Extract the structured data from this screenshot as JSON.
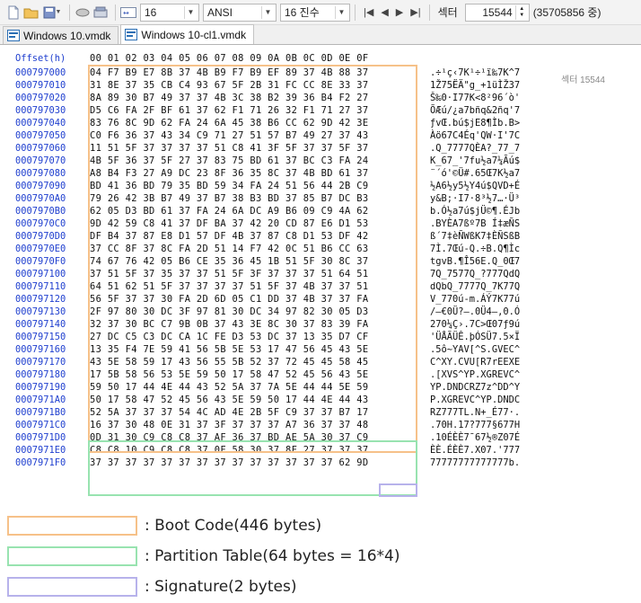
{
  "toolbar": {
    "font_size": "16",
    "charset": "ANSI",
    "radix": "16 진수",
    "sector_label": "섹터",
    "sector_value": "15544",
    "sector_total": "(35705856 중)"
  },
  "tabs": [
    {
      "label": "Windows 10.vmdk",
      "active": false
    },
    {
      "label": "Windows 10-cl1.vmdk",
      "active": true
    }
  ],
  "hex": {
    "offset_header": "Offset(h)",
    "byte_header": "00 01 02 03 04 05 06 07 08 09 0A 0B 0C 0D 0E 0F",
    "sector_note": "섹터 15544",
    "rows": [
      {
        "offset": "000797000",
        "bytes": "04 F7 B9 E7 8B 37 4B B9 F7 B9 EF 89 37 4B 88 37",
        "text": ".÷¹ç‹7K¹÷¹ï‰7K^7"
      },
      {
        "offset": "000797010",
        "bytes": "31 8E 37 35 CB C4 93 67 5F 2B 31 FC CC 8E 33 37",
        "text": "1Ž75ËÄ\"g_+1üÌŽ37"
      },
      {
        "offset": "000797020",
        "bytes": "8A 89 30 B7 49 37 37 4B 3C 38 B2 39 36 B4 F2 27",
        "text": "Š‰0·I77K<8²96´ò'"
      },
      {
        "offset": "000797030",
        "bytes": "D5 C6 FA 2F BF 61 37 62 F1 71 26 32 F1 71 27 37",
        "text": "ÕÆú/¿a7bñq&2ñq'7"
      },
      {
        "offset": "000797040",
        "bytes": "83 76 8C 9D 62 FA 24 6A 45 38 B6 CC 62 9D 42 3E",
        "text": "ƒvŒ.bú$jE8¶Ìb.B>"
      },
      {
        "offset": "000797050",
        "bytes": "C0 F6 36 37 43 34 C9 71 27 51 57 B7 49 27 37 43",
        "text": "Àö67C4Éq'QW·I'7C"
      },
      {
        "offset": "000797060",
        "bytes": "11 51 5F 37 37 37 37 51 C8 41 3F 5F 37 37 5F 37",
        "text": ".Q_7777QÈA?_77_7"
      },
      {
        "offset": "000797070",
        "bytes": "4B 5F 36 37 5F 27 37 83 75 BD 61 37 BC C3 FA 24",
        "text": "K_67_'7fu½a7¼Ãú$"
      },
      {
        "offset": "000797080",
        "bytes": "A8 B4 F3 27 A9 DC 23 8F 36 35 8C 37 4B BD 61 37",
        "text": "¨´ó'©Ü#.65Œ7K½a7"
      },
      {
        "offset": "000797090",
        "bytes": "BD 41 36 BD 79 35 BD 59 34 FA 24 51 56 44 2B C9",
        "text": "½A6½y5½Y4ú$QVD+É"
      },
      {
        "offset": "0007970A0",
        "bytes": "79 26 42 3B B7 49 37 B7 38 B3 BD 37 85 B7 DC B3",
        "text": "y&B;·I7·8³½7…·Ü³"
      },
      {
        "offset": "0007970B0",
        "bytes": "62 05 D3 BD 61 37 FA 24 6A DC A9 B6 09 C9 4A 62",
        "text": "b.Ó½a7ú$jÜ©¶.ÉJb"
      },
      {
        "offset": "0007970C0",
        "bytes": "9D 42 59 C8 41 37 DF BA 37 42 20 CD 87 E6 D1 53",
        "text": ".BYÈA7ßº7B Í‡æÑS"
      },
      {
        "offset": "0007970D0",
        "bytes": "DF B4 37 87 E8 D1 57 DF 4B 37 87 C8 D1 53 DF 42",
        "text": "ß´7‡èÑWßK7‡ÈÑSßB"
      },
      {
        "offset": "0007970E0",
        "bytes": "37 CC 8F 37 8C FA 2D 51 14 F7 42 0C 51 B6 CC 63",
        "text": "7Ì.7Œú-Q.÷B.Q¶Ìc"
      },
      {
        "offset": "0007970F0",
        "bytes": "74 67 76 42 05 B6 CE 35 36 45 1B 51 5F 30 8C 37",
        "text": "tgvB.¶Î56E.Q_0Œ7"
      },
      {
        "offset": "000797100",
        "bytes": "37 51 5F 37 35 37 37 51 5F 3F 37 37 37 51 64 51",
        "text": "7Q_7577Q_?777QdQ"
      },
      {
        "offset": "000797110",
        "bytes": "64 51 62 51 5F 37 37 37 37 51 5F 37 4B 37 37 51",
        "text": "dQbQ_7777Q_7K77Q"
      },
      {
        "offset": "000797120",
        "bytes": "56 5F 37 37 30 FA 2D 6D 05 C1 DD 37 4B 37 37 FA",
        "text": "V_770ú-m.ÁÝ7K77ú"
      },
      {
        "offset": "000797130",
        "bytes": "2F 97 80 30 DC 3F 97 81 30 DC 34 97 82 30 05 D3",
        "text": "/—€0Ü?—.0Ü4—‚0.Ó"
      },
      {
        "offset": "000797140",
        "bytes": "32 37 30 BC C7 9B 0B 37 43 3E 8C 30 37 83 39 FA",
        "text": "270¼Ç›.7C>Œ07ƒ9ú"
      },
      {
        "offset": "000797150",
        "bytes": "27 DC C5 C3 DC CA 1C FE D3 53 DC 37 13 35 D7 CF",
        "text": "'ÜÅÃÜÊ.þÓSÜ7.5×Ï"
      },
      {
        "offset": "000797160",
        "bytes": "13 35 F4 7E 59 41 56 5B 5E 53 17 47 56 45 43 5E",
        "text": ".5ô~YAV[^S.GVEC^"
      },
      {
        "offset": "000797170",
        "bytes": "43 5E 58 59 17 43 56 55 5B 52 37 72 45 45 58 45",
        "text": "C^XY.CVU[R7rEEXE"
      },
      {
        "offset": "000797180",
        "bytes": "17 5B 58 56 53 5E 59 50 17 58 47 52 45 56 43 5E",
        "text": ".[XVS^YP.XGREVC^"
      },
      {
        "offset": "000797190",
        "bytes": "59 50 17 44 4E 44 43 52 5A 37 7A 5E 44 44 5E 59",
        "text": "YP.DNDCRZ7z^DD^Y"
      },
      {
        "offset": "0007971A0",
        "bytes": "50 17 58 47 52 45 56 43 5E 59 50 17 44 4E 44 43",
        "text": "P.XGREVC^YP.DNDC"
      },
      {
        "offset": "0007971B0",
        "bytes": "52 5A 37 37 37 54 4C AD 4E 2B 5F C9 37 37 B7 17",
        "text": "RZ777TL.N+_É77·."
      },
      {
        "offset": "0007971C0",
        "bytes": "16 37 30 48 0E 31 37 3F 37 37 37 A7 36 37 37 48",
        "text": ".70H.17?777§677H"
      },
      {
        "offset": "0007971D0",
        "bytes": "0D 31 30 C9 C8 C8 37 AF 36 37 BD AE 5A 30 37 C9",
        "text": ".10ÉÈÈ7¯67½®Z07É"
      },
      {
        "offset": "0007971E0",
        "bytes": "C8 C8 10 C9 C8 C8 37 0F 58 30 37 8F 27 37 37 37",
        "text": "ÈÈ.ÉÈÈ7.X07.'777"
      },
      {
        "offset": "0007971F0",
        "bytes": "37 37 37 37 37 37 37 37 37 37 37 37 37 37 62 9D",
        "text": "77777777777777b."
      }
    ]
  },
  "legend": [
    {
      "label": "Boot Code(446 bytes)",
      "color": "#f6c189"
    },
    {
      "label": "Partition Table(64 bytes = 16*4)",
      "color": "#98e3b0"
    },
    {
      "label": "Signature(2 bytes)",
      "color": "#b7b2eb"
    }
  ],
  "colors": {
    "offset_blue": "#1f3fcf",
    "boot": "#f6c189",
    "partition": "#98e3b0",
    "signature": "#b7b2eb"
  }
}
